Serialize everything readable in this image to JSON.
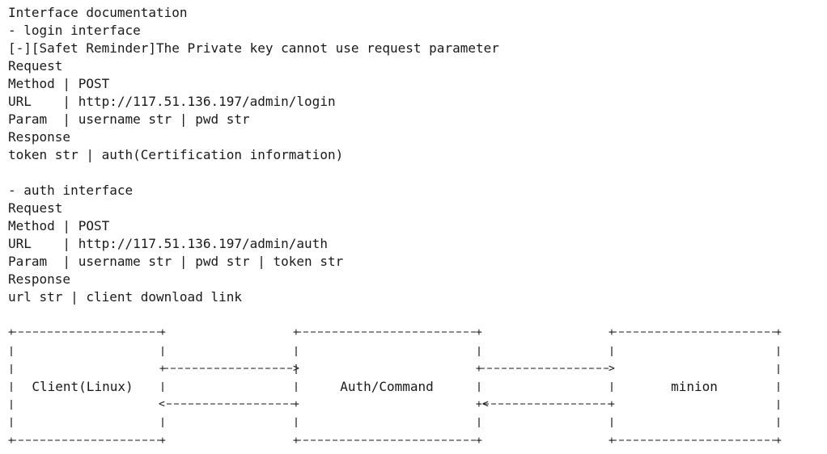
{
  "document": {
    "title": "Interface documentation",
    "login": {
      "heading": "- login interface",
      "reminder": "[-][Safet Reminder]The Private key cannot use request parameter",
      "request_label": "Request",
      "method_row": "Method | POST",
      "url_row": "URL    | http://117.51.136.197/admin/login",
      "param_row": "Param  | username str | pwd str",
      "response_label": "Response",
      "response_row": "token str | auth(Certification information)"
    },
    "auth": {
      "heading": "- auth interface",
      "request_label": "Request",
      "method_row": "Method | POST",
      "url_row": "URL    | http://117.51.136.197/admin/auth",
      "param_row": "Param  | username str | pwd str | token str",
      "response_label": "Response",
      "response_row": "url str | client download link"
    }
  },
  "diagram": {
    "boxes": {
      "client": "Client(Linux)",
      "auth_command": "Auth/Command",
      "minion": "minion"
    }
  }
}
